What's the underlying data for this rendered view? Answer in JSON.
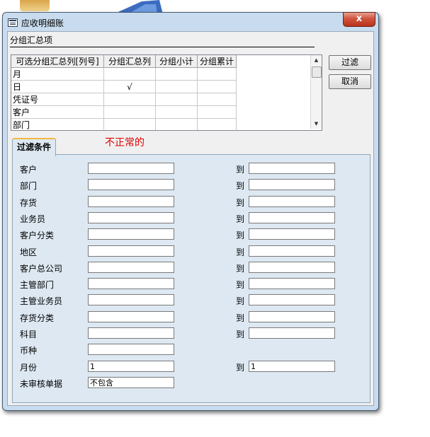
{
  "window": {
    "title": "应收明细账",
    "close_label": "x"
  },
  "grouping": {
    "label": "分组汇总项",
    "columns": [
      "可选分组汇总列[列号]",
      "分组汇总列",
      "分组小计",
      "分组累计"
    ],
    "rows": [
      [
        "月",
        "",
        "",
        ""
      ],
      [
        "日",
        "√",
        "",
        ""
      ],
      [
        "凭证号",
        "",
        "",
        ""
      ],
      [
        "客户",
        "",
        "",
        ""
      ],
      [
        "部门",
        "",
        "",
        ""
      ],
      [
        "业务员",
        "",
        "",
        ""
      ]
    ]
  },
  "buttons": {
    "filter": "过滤",
    "cancel": "取消"
  },
  "tab": {
    "label": "过滤条件"
  },
  "annotation": "不正常的",
  "to_label": "到",
  "filters": [
    {
      "label": "客户",
      "from": "",
      "to": "",
      "has_to": true
    },
    {
      "label": "部门",
      "from": "",
      "to": "",
      "has_to": true
    },
    {
      "label": "存货",
      "from": "",
      "to": "",
      "has_to": true
    },
    {
      "label": "业务员",
      "from": "",
      "to": "",
      "has_to": true
    },
    {
      "label": "客户分类",
      "from": "",
      "to": "",
      "has_to": true
    },
    {
      "label": "地区",
      "from": "",
      "to": "",
      "has_to": true
    },
    {
      "label": "客户总公司",
      "from": "",
      "to": "",
      "has_to": true
    },
    {
      "label": "主管部门",
      "from": "",
      "to": "",
      "has_to": true
    },
    {
      "label": "主管业务员",
      "from": "",
      "to": "",
      "has_to": true
    },
    {
      "label": "存货分类",
      "from": "",
      "to": "",
      "has_to": true
    },
    {
      "label": "科目",
      "from": "",
      "to": "",
      "has_to": true
    },
    {
      "label": "币种",
      "from": "",
      "to": "",
      "has_to": false
    },
    {
      "label": "月份",
      "from": "1",
      "to": "1",
      "has_to": true
    },
    {
      "label": "未审核单据",
      "from": "不包含",
      "to": "",
      "has_to": false
    }
  ]
}
